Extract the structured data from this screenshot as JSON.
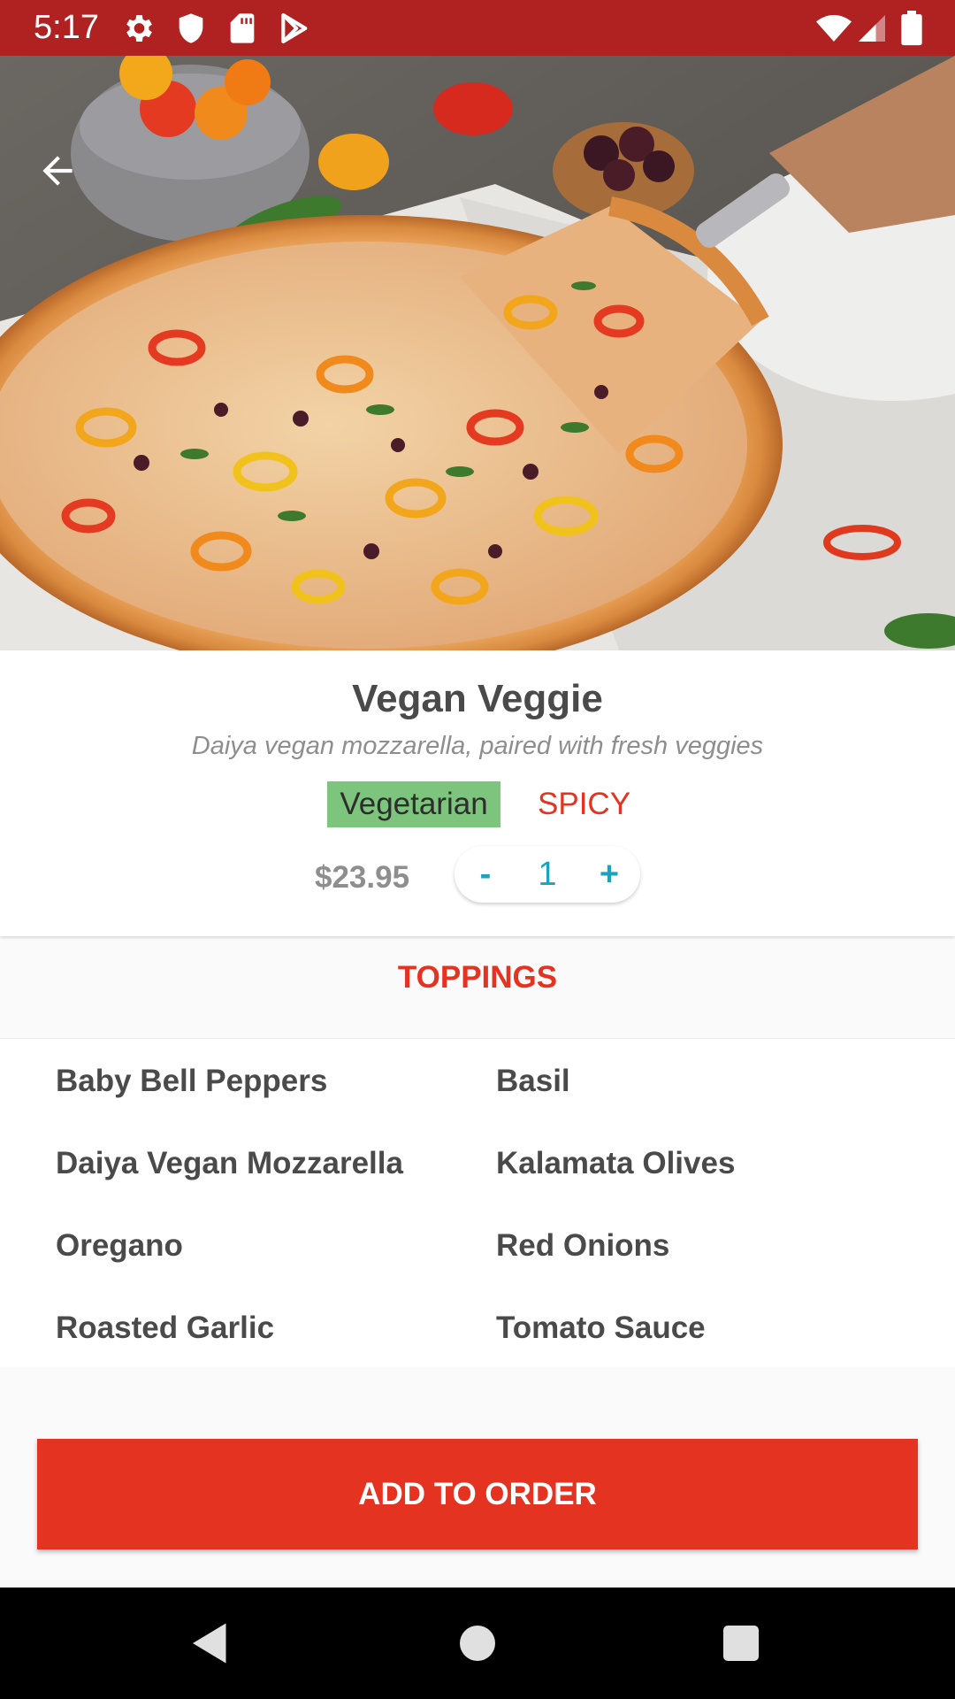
{
  "status_bar": {
    "time": "5:17",
    "icons": [
      "gear-icon",
      "shield-icon",
      "sd-card-icon",
      "play-store-icon",
      "wifi-icon",
      "signal-icon",
      "battery-icon"
    ]
  },
  "header": {
    "back_icon": "arrow-left-icon"
  },
  "product": {
    "name": "Vegan Veggie",
    "description": "Daiya vegan mozzarella, paired with fresh veggies",
    "tags": {
      "vegetarian": "Vegetarian",
      "spicy": "SPICY"
    },
    "price": "$23.95",
    "quantity": {
      "minus": "-",
      "value": "1",
      "plus": "+"
    }
  },
  "toppings": {
    "header": "TOPPINGS",
    "items": [
      "Baby Bell Peppers",
      "Basil",
      "Daiya Vegan Mozzarella",
      "Kalamata Olives",
      "Oregano",
      "Red Onions",
      "Roasted Garlic",
      "Tomato Sauce"
    ]
  },
  "actions": {
    "add_to_order": "ADD TO ORDER"
  },
  "colors": {
    "status_bar": "#b02121",
    "accent_red": "#e53322",
    "vegetarian_badge": "#7dc57c",
    "stepper_text": "#1ba3be",
    "text_dark": "#4a4a4a",
    "text_muted": "#8e8e8e"
  },
  "nav_bar": {
    "icons": [
      "back-triangle-icon",
      "home-circle-icon",
      "recents-square-icon"
    ]
  }
}
